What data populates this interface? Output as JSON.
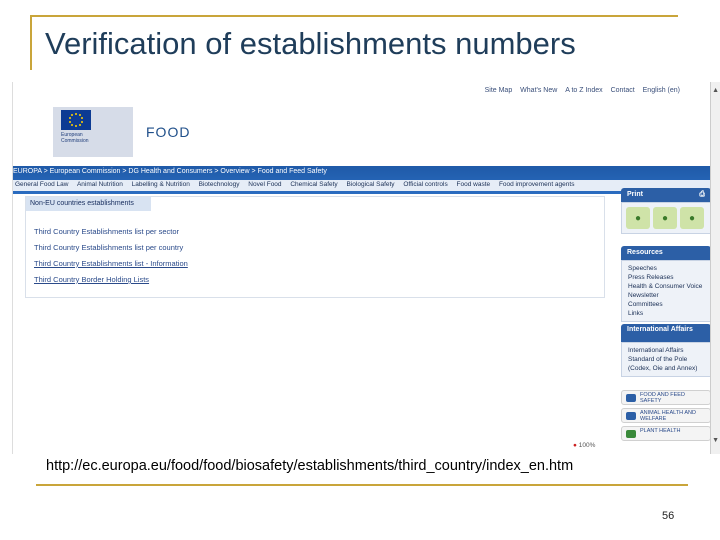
{
  "slide": {
    "title": "Verification of establishments numbers",
    "url": "http://ec.europa.eu/food/food/biosafety/establishments/third_country/index_en.htm",
    "page_number": "56"
  },
  "browser": {
    "top_links": [
      "Site Map",
      "What's New",
      "A to Z Index",
      "Contact",
      "English (en)"
    ],
    "logo_text": "European Commission",
    "section_label": "FOOD",
    "breadcrumb": "EUROPA > European Commission > DG Health and Consumers > Overview > Food and Feed Safety",
    "menu": [
      "General Food Law",
      "Animal Nutrition",
      "Labelling & Nutrition",
      "Biotechnology",
      "Novel Food",
      "Chemical Safety",
      "Biological Safety",
      "Official controls",
      "Food waste",
      "Food improvement agents"
    ],
    "box_title": "Non-EU countries establishments",
    "links": [
      {
        "label": "Third Country Establishments list per sector",
        "underline": false
      },
      {
        "label": "Third Country Establishments list per country",
        "underline": false
      },
      {
        "label": "Third Country Establishments list - Information",
        "underline": true
      },
      {
        "label": "Third Country Border Holding Lists",
        "underline": true
      }
    ],
    "sidebar": {
      "print_label": "Print",
      "resources_head": "Resources",
      "resources_items": [
        "Speeches",
        "Press Releases",
        "Health & Consumer Voice Newsletter",
        "Committees",
        "Links"
      ],
      "intl_head": "International Affairs",
      "intl_items": [
        "International Affairs",
        "Standard of the Pole (Codex, Oie and Annex)"
      ],
      "badges": [
        "FOOD AND FEED SAFETY",
        "ANIMAL HEALTH AND WELFARE",
        "PLANT HEALTH"
      ]
    },
    "status_zoom": "100%"
  },
  "colors": {
    "gold": "#c9a53a",
    "title": "#1f3d5a",
    "eu_blue": "#0d3b93",
    "band_blue": "#2a6cc0"
  }
}
